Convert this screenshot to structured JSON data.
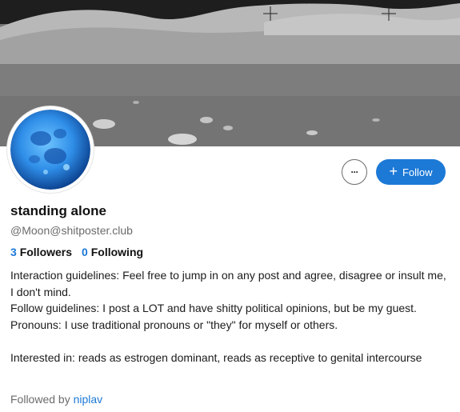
{
  "banner": {
    "description_icon": "moon-landscape-image"
  },
  "avatar": {
    "icon": "moon-avatar-icon"
  },
  "actions": {
    "more_icon": "ellipsis-icon",
    "more_label": "···",
    "follow_icon": "plus-icon",
    "follow_label": "Follow"
  },
  "profile": {
    "display_name": "standing alone",
    "handle": "@Moon@shitposter.club",
    "followers_count": "3",
    "followers_label": "Followers",
    "following_count": "0",
    "following_label": "Following"
  },
  "bio": {
    "line1": "Interaction guidelines: Feel free to jump in on any post and agree, disagree or insult me, I don't mind.",
    "line2": "Follow guidelines: I post a LOT and have shitty political opinions, but be my guest.",
    "line3": "Pronouns: I use traditional pronouns or \"they\" for myself or others.",
    "line4": "Interested in: reads as estrogen dominant, reads as receptive to genital intercourse"
  },
  "followed_by": {
    "prefix": "Followed by ",
    "user": "niplav"
  },
  "colors": {
    "accent": "#1c79d6",
    "muted": "#6b6b6b"
  }
}
